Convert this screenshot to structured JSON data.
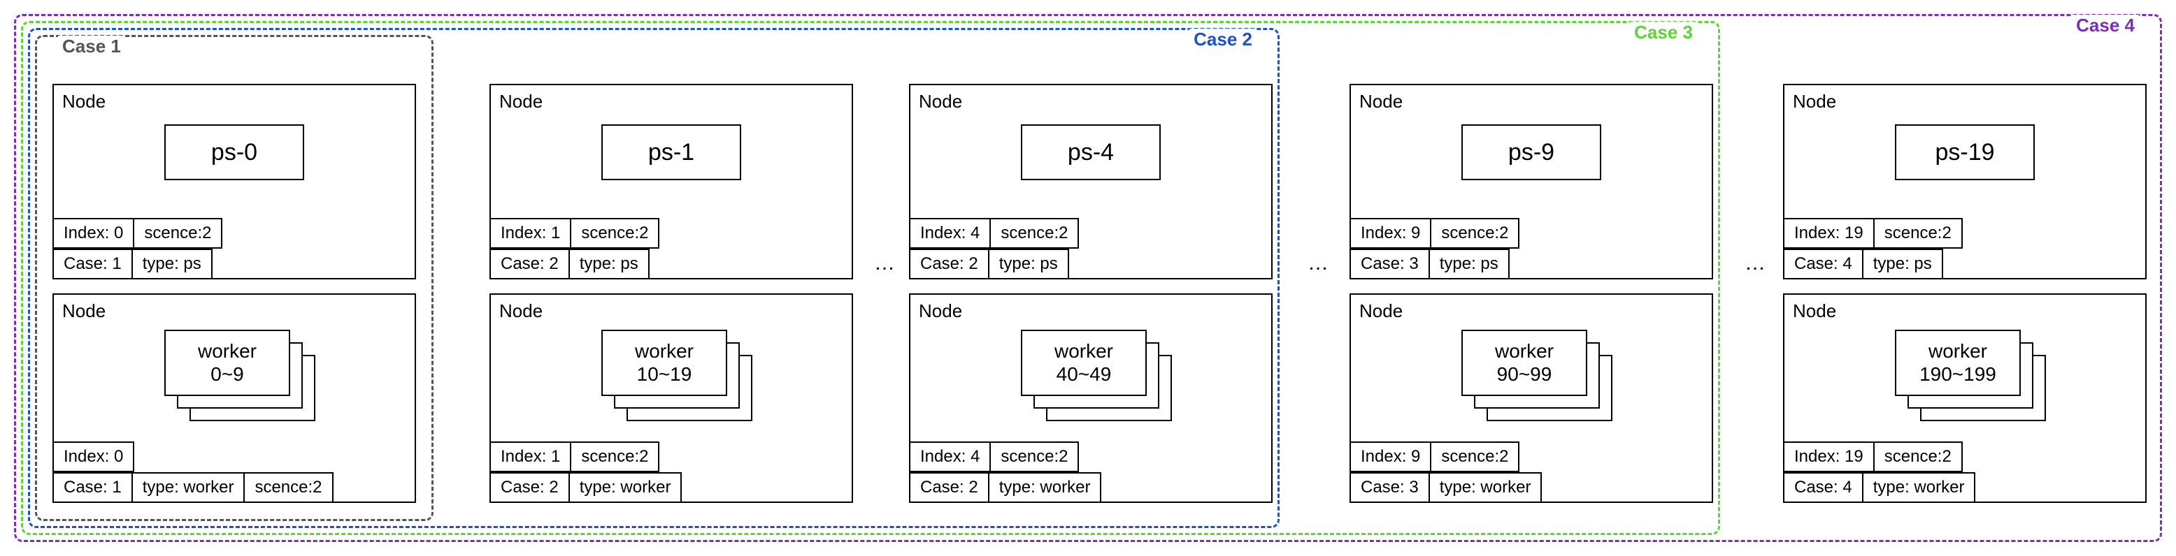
{
  "cases": [
    {
      "label": "Case 1",
      "color": "#555555"
    },
    {
      "label": "Case 2",
      "color": "#1e50c8"
    },
    {
      "label": "Case 3",
      "color": "#5fd43a"
    },
    {
      "label": "Case 4",
      "color": "#7a2fb5"
    }
  ],
  "columns": [
    {
      "ps": {
        "title": "Node",
        "name": "ps-0",
        "tags1": [
          "Index: 0",
          "scence:2"
        ],
        "tags2": [
          "Case: 1",
          "type: ps"
        ]
      },
      "worker": {
        "title": "Node",
        "label": "worker",
        "range": "0~9",
        "tags1": [
          "Index: 0"
        ],
        "tags2": [
          "Case: 1",
          "type: worker",
          "scence:2"
        ]
      }
    },
    {
      "ps": {
        "title": "Node",
        "name": "ps-1",
        "tags1": [
          "Index: 1",
          "scence:2"
        ],
        "tags2": [
          "Case: 2",
          "type: ps"
        ]
      },
      "worker": {
        "title": "Node",
        "label": "worker",
        "range": "10~19",
        "tags1": [
          "Index: 1",
          "scence:2"
        ],
        "tags2": [
          "Case: 2",
          "type: worker"
        ]
      }
    },
    {
      "ps": {
        "title": "Node",
        "name": "ps-4",
        "tags1": [
          "Index: 4",
          "scence:2"
        ],
        "tags2": [
          "Case: 2",
          "type: ps"
        ]
      },
      "worker": {
        "title": "Node",
        "label": "worker",
        "range": "40~49",
        "tags1": [
          "Index: 4",
          "scence:2"
        ],
        "tags2": [
          "Case: 2",
          "type: worker"
        ]
      }
    },
    {
      "ps": {
        "title": "Node",
        "name": "ps-9",
        "tags1": [
          "Index: 9",
          "scence:2"
        ],
        "tags2": [
          "Case: 3",
          "type: ps"
        ]
      },
      "worker": {
        "title": "Node",
        "label": "worker",
        "range": "90~99",
        "tags1": [
          "Index: 9",
          "scence:2"
        ],
        "tags2": [
          "Case: 3",
          "type: worker"
        ]
      }
    },
    {
      "ps": {
        "title": "Node",
        "name": "ps-19",
        "tags1": [
          "Index: 19",
          "scence:2"
        ],
        "tags2": [
          "Case: 4",
          "type: ps"
        ]
      },
      "worker": {
        "title": "Node",
        "label": "worker",
        "range": "190~199",
        "tags1": [
          "Index: 19",
          "scence:2"
        ],
        "tags2": [
          "Case: 4",
          "type: worker"
        ]
      }
    }
  ],
  "ellipsis": "…"
}
